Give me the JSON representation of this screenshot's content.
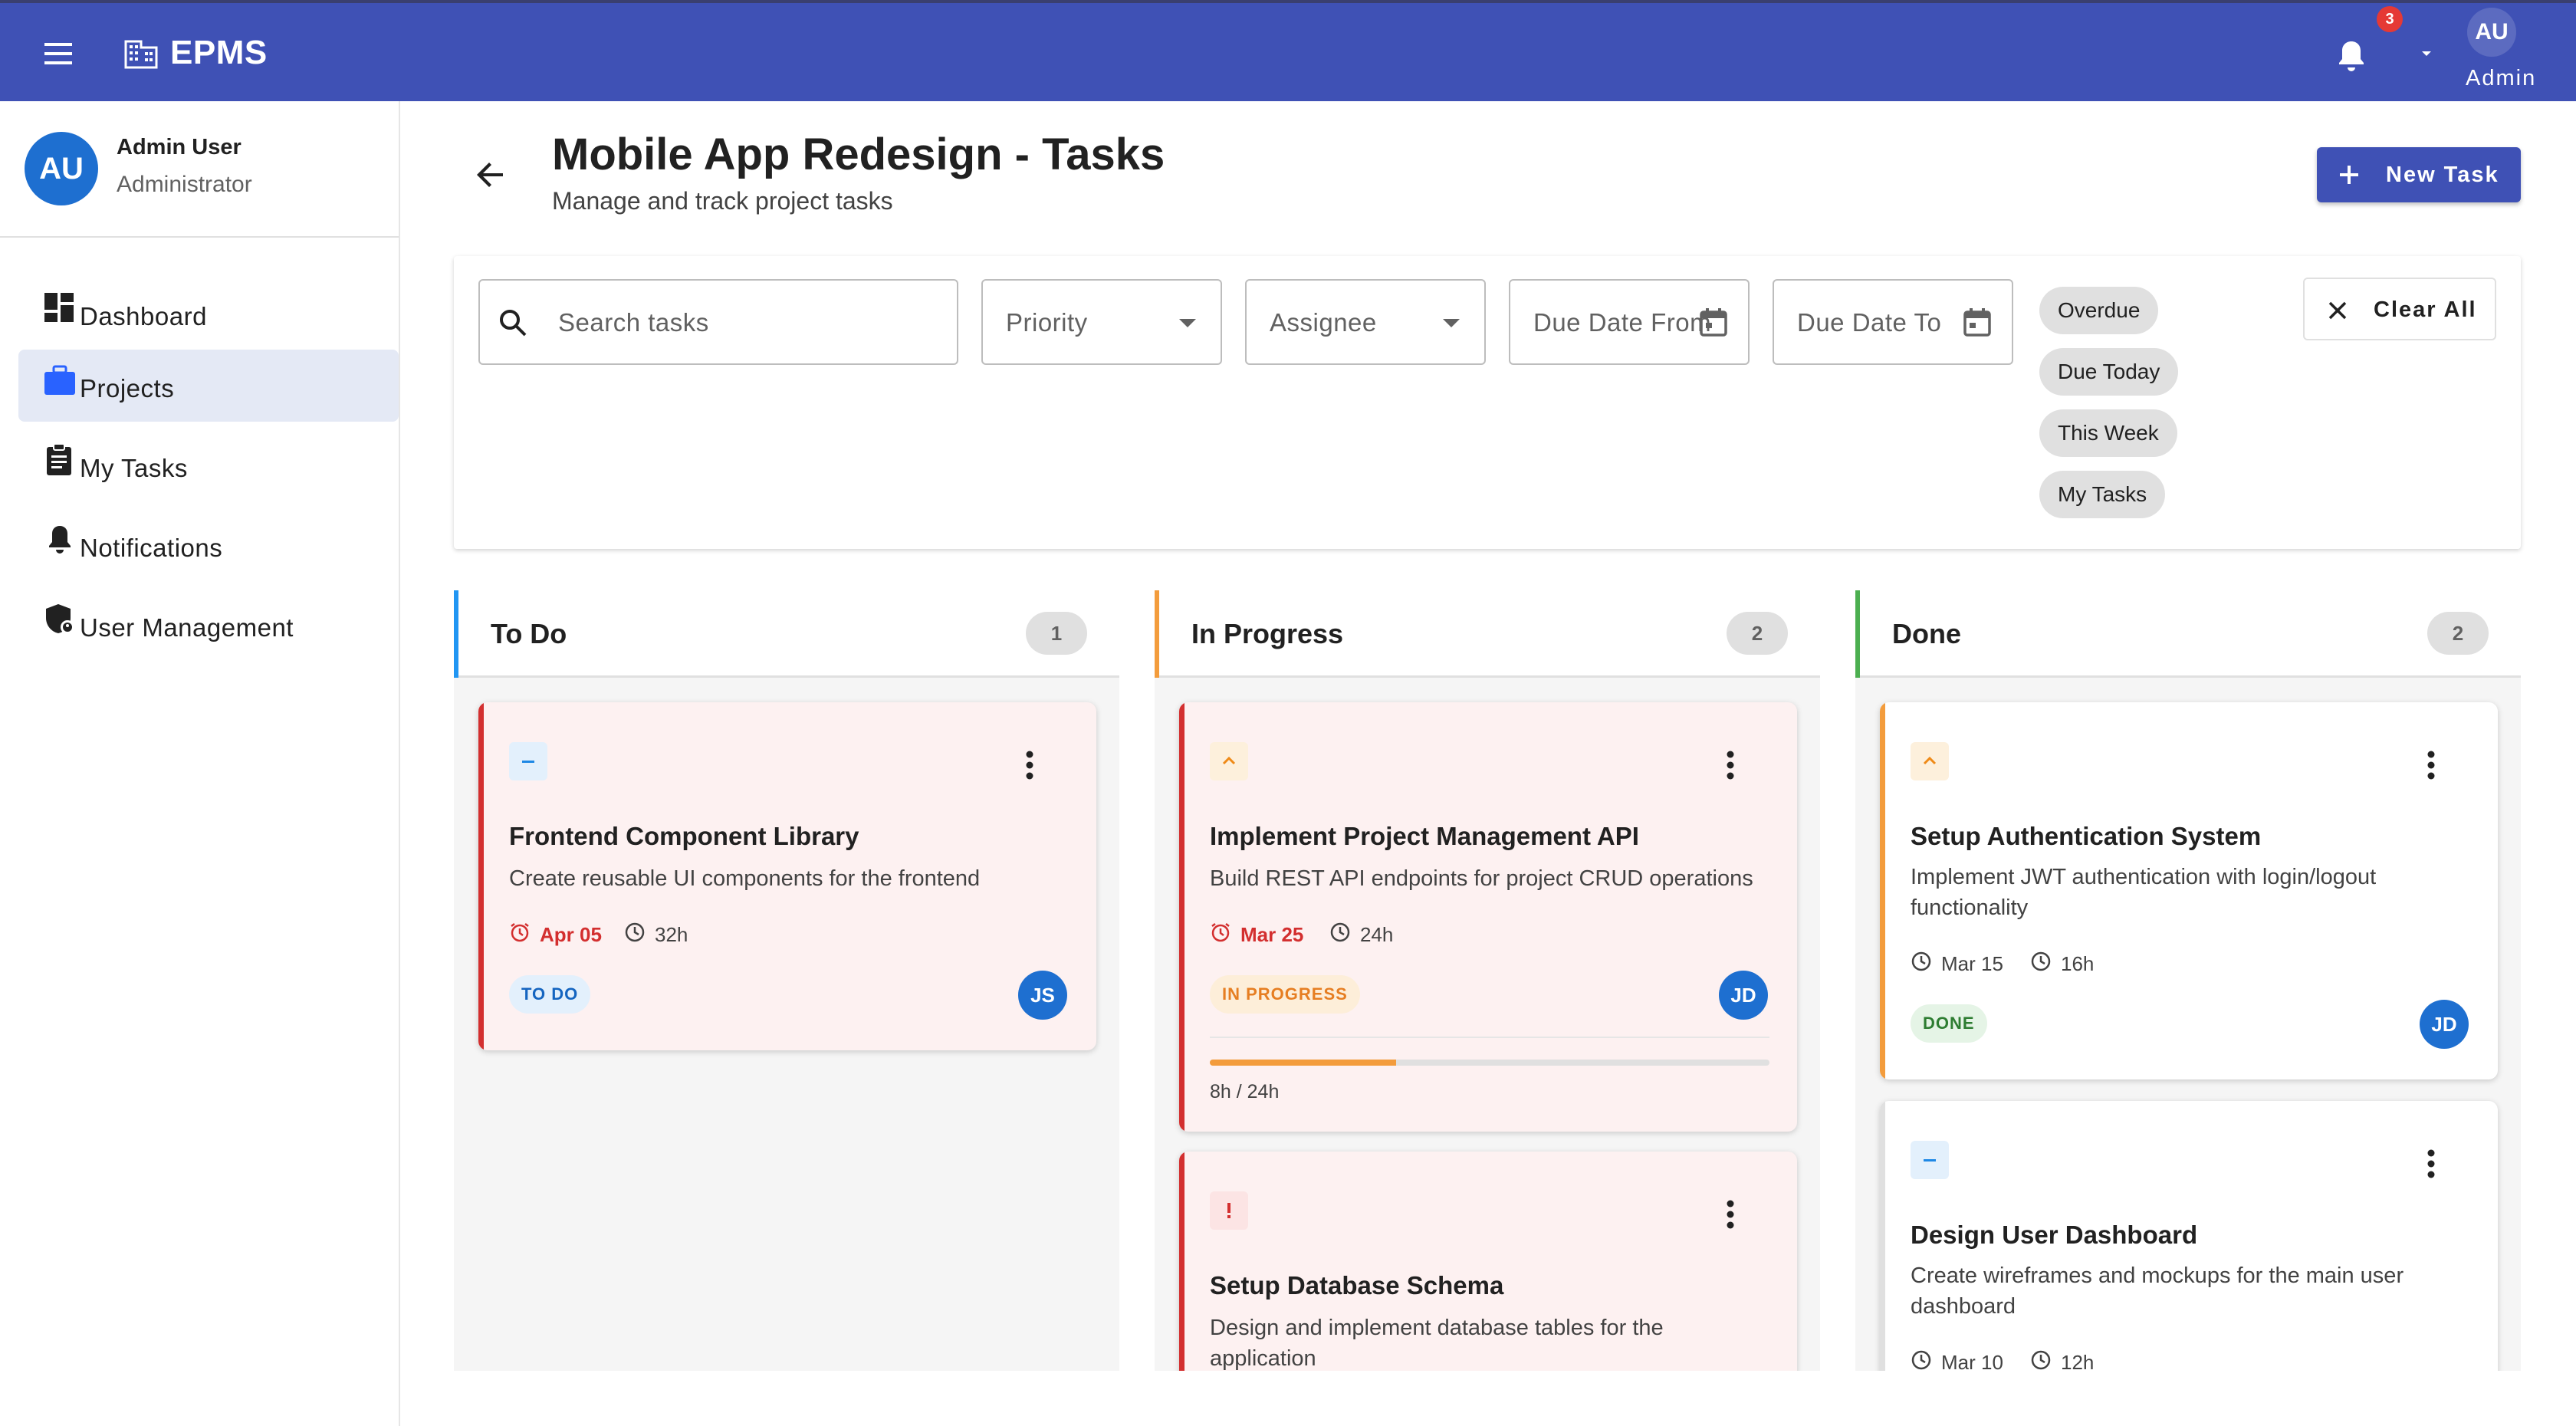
{
  "app": {
    "brand": "EPMS",
    "notification_count": "3",
    "user_initials": "AU",
    "user_role_label": "Admin"
  },
  "sidebar": {
    "profile": {
      "initials": "AU",
      "name": "Admin User",
      "role": "Administrator"
    },
    "items": [
      {
        "label": "Dashboard",
        "icon": "dashboard-icon",
        "active": false
      },
      {
        "label": "Projects",
        "icon": "briefcase-icon",
        "active": true
      },
      {
        "label": "My Tasks",
        "icon": "clipboard-icon",
        "active": false
      },
      {
        "label": "Notifications",
        "icon": "bell-icon",
        "active": false
      },
      {
        "label": "User Management",
        "icon": "admin-shield-icon",
        "active": false
      }
    ]
  },
  "page": {
    "title": "Mobile App Redesign - Tasks",
    "subtitle": "Manage and track project tasks",
    "new_task_label": "New Task"
  },
  "filters": {
    "search_placeholder": "Search tasks",
    "priority_placeholder": "Priority",
    "assignee_placeholder": "Assignee",
    "due_from_placeholder": "Due Date From",
    "due_to_placeholder": "Due Date To",
    "quick_chips": [
      "Overdue",
      "Due Today",
      "This Week",
      "My Tasks"
    ],
    "clear_label": "Clear All"
  },
  "colors": {
    "primary": "#3f51b5",
    "todo": "#2196f3",
    "in_progress": "#f39c3c",
    "done": "#4caf50",
    "overdue": "#d32f2f"
  },
  "board": {
    "columns": [
      {
        "title": "To Do",
        "count": "1",
        "cards": [
          {
            "priority": "medium",
            "title": "Frontend Component Library",
            "description": "Create reusable UI components for the frontend",
            "due": "Apr 05",
            "due_overdue": true,
            "estimate": "32h",
            "status": "TO DO",
            "assignee": "JS"
          }
        ]
      },
      {
        "title": "In Progress",
        "count": "2",
        "cards": [
          {
            "priority": "high",
            "title": "Implement Project Management API",
            "description": "Build REST API endpoints for project CRUD operations",
            "due": "Mar 25",
            "due_overdue": true,
            "estimate": "24h",
            "status": "IN PROGRESS",
            "assignee": "JD",
            "progress_label": "8h / 24h",
            "progress_fraction": 0.333
          },
          {
            "priority": "urgent",
            "title": "Setup Database Schema",
            "description": "Design and implement database tables for the application"
          }
        ]
      },
      {
        "title": "Done",
        "count": "2",
        "cards": [
          {
            "priority": "high",
            "title": "Setup Authentication System",
            "description": "Implement JWT authentication with login/logout functionality",
            "due": "Mar 15",
            "due_overdue": false,
            "estimate": "16h",
            "status": "DONE",
            "assignee": "JD"
          },
          {
            "priority": "medium",
            "title": "Design User Dashboard",
            "description": "Create wireframes and mockups for the main user dashboard",
            "due": "Mar 10",
            "estimate": "12h"
          }
        ]
      }
    ]
  }
}
